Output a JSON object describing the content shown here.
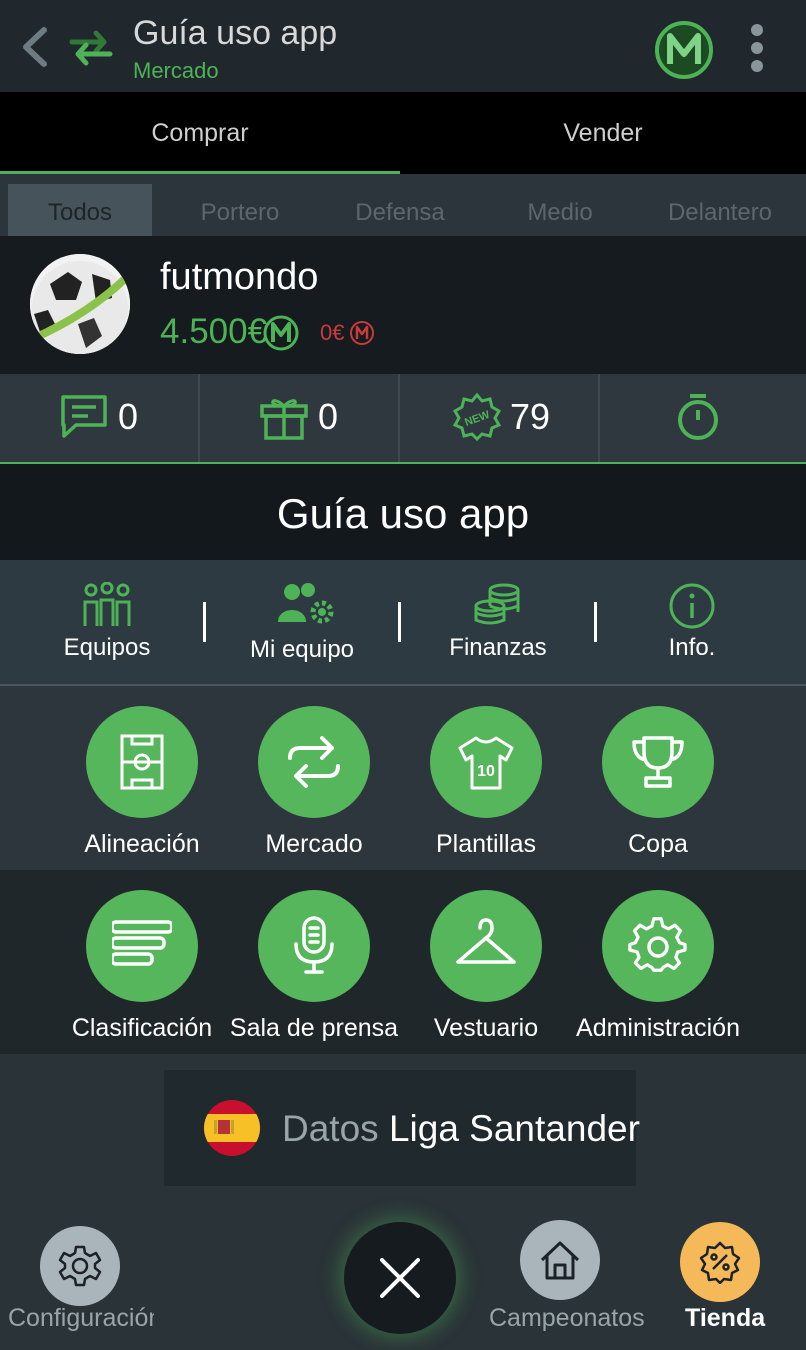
{
  "header": {
    "title": "Guía uso app",
    "subtitle": "Mercado"
  },
  "tabs": {
    "buy": "Comprar",
    "sell": "Vender"
  },
  "filters": [
    "Todos",
    "Portero",
    "Defensa",
    "Medio",
    "Delantero"
  ],
  "profile": {
    "name": "futmondo",
    "money": "4.500€",
    "debt": "0€"
  },
  "stats": {
    "messages": "0",
    "gifts": "0",
    "new": "79"
  },
  "guide_title": "Guía uso app",
  "quick_nav": [
    "Equipos",
    "Mi equipo",
    "Finanzas",
    "Info."
  ],
  "grid": [
    "Alineación",
    "Mercado",
    "Plantillas",
    "Copa",
    "Clasificación",
    "Sala de prensa",
    "Vestuario",
    "Administración"
  ],
  "datos": {
    "prefix": "Datos",
    "league": "Liga Santander"
  },
  "bottom_nav": {
    "config": "Configuración",
    "campeonatos": "Campeonatos",
    "tienda": "Tienda"
  },
  "colors": {
    "accent": "#4db356",
    "shop": "#f5b95a",
    "debt": "#c93b3b"
  }
}
